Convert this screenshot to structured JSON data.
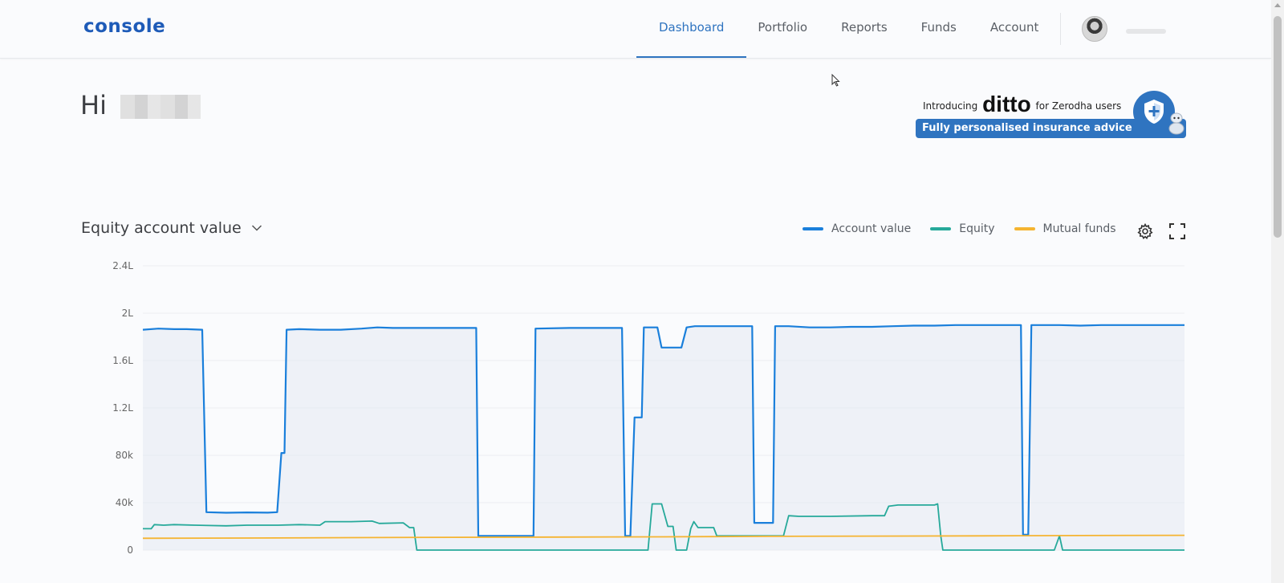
{
  "header": {
    "logo": "console",
    "nav": [
      "Dashboard",
      "Portfolio",
      "Reports",
      "Funds",
      "Account"
    ],
    "active_nav": "Dashboard"
  },
  "greeting": {
    "text": "Hi"
  },
  "banner": {
    "intro": "Introducing",
    "brand": "ditto",
    "suffix": "for Zerodha users",
    "tagline": "Fully personalised insurance advice"
  },
  "chart_header": {
    "title": "Equity account value",
    "legend": [
      {
        "name": "Account value",
        "color": "#1a7fdb"
      },
      {
        "name": "Equity",
        "color": "#26a99a"
      },
      {
        "name": "Mutual funds",
        "color": "#f5b431"
      }
    ]
  },
  "chart_data": {
    "type": "line",
    "y_ticks": [
      "0",
      "40k",
      "80k",
      "1.2L",
      "1.6L",
      "2L",
      "2.4L"
    ],
    "y_tick_values": [
      0,
      40000,
      80000,
      120000,
      160000,
      200000,
      240000
    ],
    "ylim": [
      0,
      240000
    ],
    "xlim": [
      0,
      100
    ],
    "grid": true,
    "legend_position": "top-right",
    "series": [
      {
        "name": "Account value",
        "color": "#1a7fdb",
        "fill": true,
        "points": [
          [
            0,
            186000
          ],
          [
            1.5,
            187000
          ],
          [
            3,
            186500
          ],
          [
            4.2,
            186500
          ],
          [
            5.7,
            186000
          ],
          [
            6.1,
            32000
          ],
          [
            8,
            31500
          ],
          [
            10,
            31800
          ],
          [
            12,
            31600
          ],
          [
            12.9,
            32000
          ],
          [
            13.3,
            82000
          ],
          [
            13.6,
            82000
          ],
          [
            13.8,
            186000
          ],
          [
            15,
            186500
          ],
          [
            17,
            186000
          ],
          [
            19,
            186000
          ],
          [
            21,
            187000
          ],
          [
            22.5,
            188000
          ],
          [
            24,
            187500
          ],
          [
            26,
            187500
          ],
          [
            28,
            187500
          ],
          [
            32,
            187500
          ],
          [
            32.2,
            12000
          ],
          [
            37.5,
            12000
          ],
          [
            37.7,
            187000
          ],
          [
            41,
            187500
          ],
          [
            46,
            187500
          ],
          [
            46.3,
            12000
          ],
          [
            46.8,
            12000
          ],
          [
            47.2,
            112000
          ],
          [
            47.9,
            112000
          ],
          [
            48.1,
            188000
          ],
          [
            49.4,
            188000
          ],
          [
            49.8,
            171000
          ],
          [
            51.7,
            171000
          ],
          [
            52.2,
            188000
          ],
          [
            53,
            189000
          ],
          [
            58.5,
            189000
          ],
          [
            58.7,
            23000
          ],
          [
            60.5,
            23000
          ],
          [
            60.7,
            189000
          ],
          [
            62,
            189000
          ],
          [
            64,
            188000
          ],
          [
            66,
            188000
          ],
          [
            68,
            188500
          ],
          [
            70,
            188500
          ],
          [
            72,
            189000
          ],
          [
            74,
            189500
          ],
          [
            76,
            189500
          ],
          [
            78,
            190000
          ],
          [
            80,
            190000
          ],
          [
            84.3,
            190000
          ],
          [
            84.5,
            13000
          ],
          [
            85,
            13000
          ],
          [
            85.3,
            190000
          ],
          [
            88,
            190000
          ],
          [
            90,
            189500
          ],
          [
            92,
            190000
          ],
          [
            95,
            190000
          ],
          [
            100,
            190000
          ]
        ]
      },
      {
        "name": "Equity",
        "color": "#26a99a",
        "fill": false,
        "points": [
          [
            0,
            18000
          ],
          [
            0.8,
            18000
          ],
          [
            1.1,
            21500
          ],
          [
            2,
            21000
          ],
          [
            3,
            21500
          ],
          [
            5,
            21000
          ],
          [
            8,
            20500
          ],
          [
            10,
            21000
          ],
          [
            13,
            21000
          ],
          [
            15,
            21500
          ],
          [
            17,
            21000
          ],
          [
            17.5,
            24000
          ],
          [
            20,
            24000
          ],
          [
            22,
            24500
          ],
          [
            22.7,
            22500
          ],
          [
            25,
            23000
          ],
          [
            25.6,
            19000
          ],
          [
            26,
            19000
          ],
          [
            26.3,
            0
          ],
          [
            48.5,
            0
          ],
          [
            48.9,
            39000
          ],
          [
            49.8,
            39000
          ],
          [
            50.4,
            20000
          ],
          [
            50.9,
            20000
          ],
          [
            51.2,
            0
          ],
          [
            52.2,
            0
          ],
          [
            52.6,
            18000
          ],
          [
            52.9,
            24000
          ],
          [
            53.3,
            19000
          ],
          [
            54.8,
            19000
          ],
          [
            55.1,
            12000
          ],
          [
            61.5,
            12000
          ],
          [
            62,
            29000
          ],
          [
            63,
            28500
          ],
          [
            66,
            28500
          ],
          [
            70,
            29000
          ],
          [
            71.2,
            29000
          ],
          [
            71.6,
            37000
          ],
          [
            72.5,
            38000
          ],
          [
            76,
            38000
          ],
          [
            76.3,
            39000
          ],
          [
            76.6,
            12000
          ],
          [
            76.8,
            0
          ],
          [
            87.5,
            0
          ],
          [
            88,
            12000
          ],
          [
            88.3,
            0
          ],
          [
            90,
            0
          ],
          [
            95,
            0
          ],
          [
            100,
            0
          ]
        ]
      },
      {
        "name": "Mutual funds",
        "color": "#f5b431",
        "fill": false,
        "points": [
          [
            0,
            10000
          ],
          [
            10,
            10200
          ],
          [
            20,
            10500
          ],
          [
            30,
            10800
          ],
          [
            40,
            11000
          ],
          [
            50,
            11200
          ],
          [
            60,
            11600
          ],
          [
            70,
            11800
          ],
          [
            80,
            12000
          ],
          [
            90,
            12300
          ],
          [
            100,
            12500
          ]
        ]
      }
    ]
  }
}
